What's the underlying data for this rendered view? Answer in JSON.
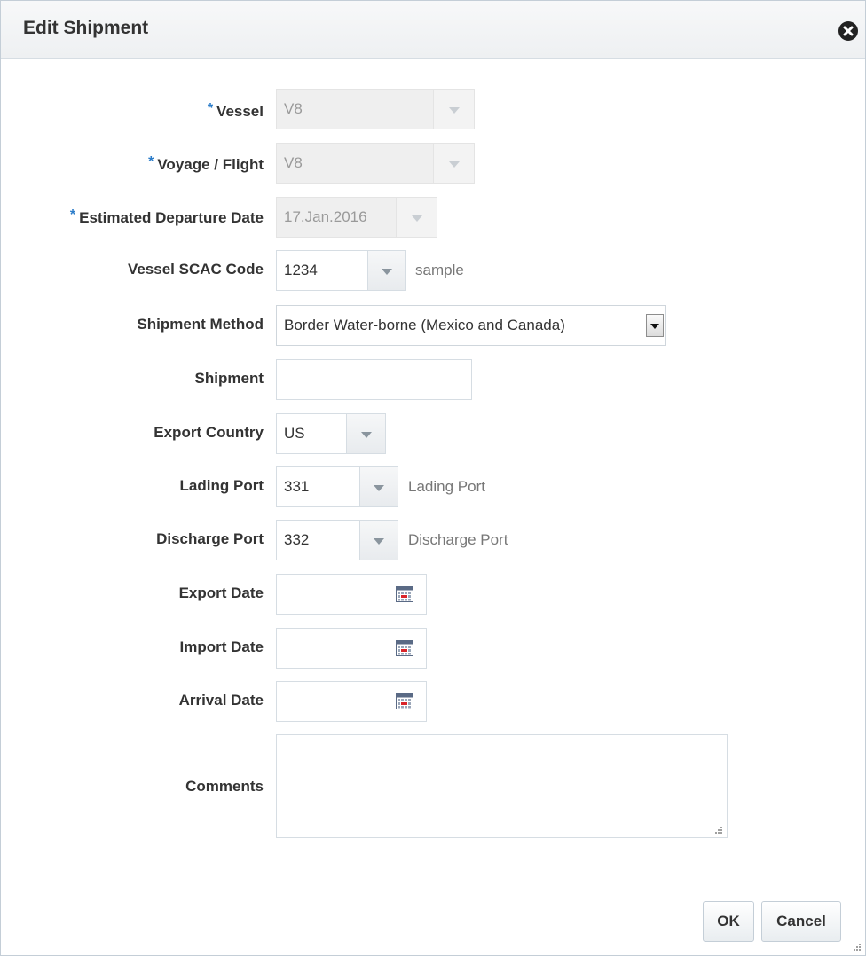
{
  "dialog": {
    "title": "Edit Shipment"
  },
  "form": {
    "required_marker": "*",
    "vessel": {
      "label": "Vessel",
      "value": "V8"
    },
    "voyage_flight": {
      "label": "Voyage / Flight",
      "value": "V8"
    },
    "estimated_departure_date": {
      "label": "Estimated Departure Date",
      "value": "17.Jan.2016"
    },
    "vessel_scac_code": {
      "label": "Vessel SCAC Code",
      "value": "1234",
      "hint": "sample"
    },
    "shipment_method": {
      "label": "Shipment Method",
      "value": "Border Water-borne (Mexico and Canada)"
    },
    "shipment": {
      "label": "Shipment",
      "value": ""
    },
    "export_country": {
      "label": "Export Country",
      "value": "US"
    },
    "lading_port": {
      "label": "Lading Port",
      "value": "331",
      "hint": "Lading Port"
    },
    "discharge_port": {
      "label": "Discharge Port",
      "value": "332",
      "hint": "Discharge Port"
    },
    "export_date": {
      "label": "Export Date",
      "value": ""
    },
    "import_date": {
      "label": "Import Date",
      "value": ""
    },
    "arrival_date": {
      "label": "Arrival Date",
      "value": ""
    },
    "comments": {
      "label": "Comments",
      "value": ""
    }
  },
  "buttons": {
    "ok": "OK",
    "cancel": "Cancel"
  },
  "colors": {
    "required": "#2b7cc9",
    "calendar_red": "#d9252a"
  }
}
